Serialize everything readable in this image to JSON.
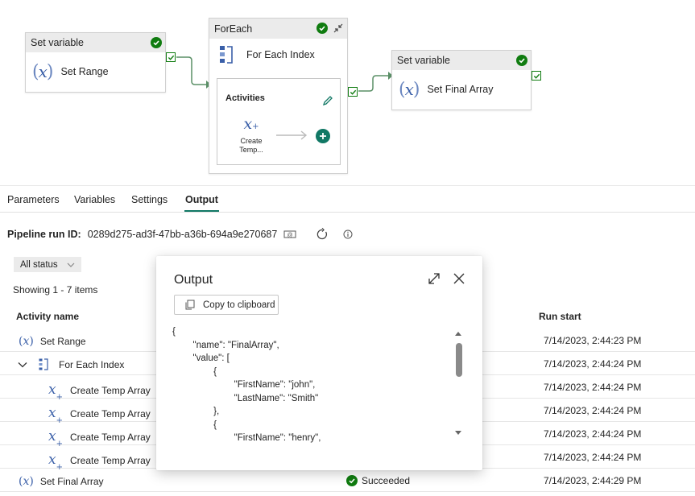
{
  "pipeline": {
    "set_range_node": {
      "header": "Set variable",
      "label": "Set Range"
    },
    "foreach_node": {
      "header": "ForEach",
      "label": "For Each Index",
      "activities_title": "Activities",
      "inner_activity_label_line1": "Create",
      "inner_activity_label_line2": "Temp..."
    },
    "set_final_node": {
      "header": "Set variable",
      "label": "Set Final Array"
    }
  },
  "tabs": [
    "Parameters",
    "Variables",
    "Settings",
    "Output"
  ],
  "active_tab": "Output",
  "run": {
    "label": "Pipeline run ID:",
    "id": "0289d275-ad3f-47bb-a36b-694a9e270687"
  },
  "filter": {
    "status_label": "All status"
  },
  "showing": "Showing 1 - 7 items",
  "columns": {
    "activity_name": "Activity name",
    "run_start": "Run start"
  },
  "rows": [
    {
      "name": "Set Range",
      "type": "variable",
      "status": "",
      "run_start": "7/14/2023, 2:44:23 PM"
    },
    {
      "name": "For Each Index",
      "type": "foreach",
      "status": "",
      "run_start": "7/14/2023, 2:44:24 PM"
    },
    {
      "name": "Create Temp Array",
      "type": "append",
      "status": "",
      "run_start": "7/14/2023, 2:44:24 PM"
    },
    {
      "name": "Create Temp Array",
      "type": "append",
      "status": "",
      "run_start": "7/14/2023, 2:44:24 PM"
    },
    {
      "name": "Create Temp Array",
      "type": "append",
      "status": "",
      "run_start": "7/14/2023, 2:44:24 PM"
    },
    {
      "name": "Create Temp Array",
      "type": "append",
      "status": "",
      "run_start": "7/14/2023, 2:44:24 PM"
    },
    {
      "name": "Set Final Array",
      "type": "variable",
      "status": "Succeeded",
      "run_start": "7/14/2023, 2:44:29 PM"
    }
  ],
  "output_dialog": {
    "title": "Output",
    "copy_label": "Copy to clipboard",
    "json_lines": [
      "{",
      "        \"name\": \"FinalArray\",",
      "        \"value\": [",
      "                {",
      "                        \"FirstName\": \"john\",",
      "                        \"LastName\": \"Smith\"",
      "                },",
      "                {",
      "                        \"FirstName\": \"henry\","
    ]
  },
  "colors": {
    "accent": "#117865",
    "success": "#107c10",
    "variable_icon": "#3a5fa8"
  },
  "icons": [
    "check-circle-icon",
    "variable-icon",
    "foreach-icon",
    "append-variable-icon",
    "plus-circle-icon",
    "pencil-icon",
    "expand-icon",
    "close-icon",
    "copy-icon",
    "refresh-icon",
    "info-icon",
    "chevron-down-icon",
    "json-view-icon"
  ]
}
